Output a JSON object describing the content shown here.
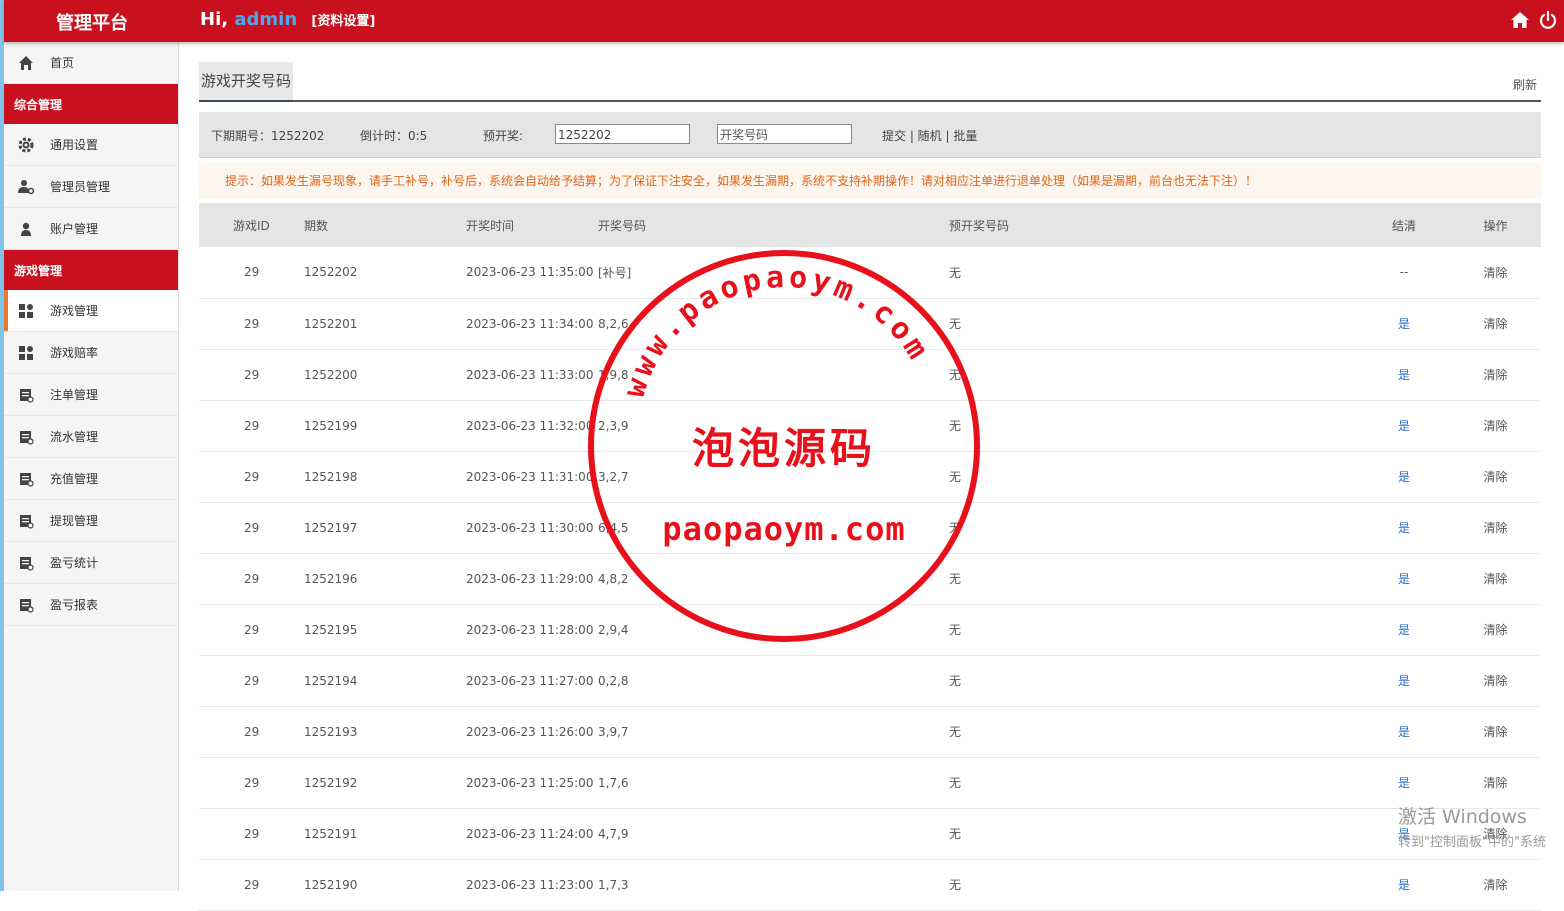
{
  "header": {
    "brand": "管理平台",
    "greeting": "Hi,",
    "user": "admin",
    "settings": "[资料设置]",
    "icons": [
      "home-icon",
      "power-icon"
    ]
  },
  "sidebar": {
    "home": "首页",
    "section1": "综合管理",
    "general": [
      "通用设置",
      "管理员管理",
      "账户管理"
    ],
    "section2": "游戏管理",
    "game": [
      "游戏管理",
      "游戏赔率",
      "注单管理",
      "流水管理",
      "充值管理",
      "提现管理",
      "盈亏统计",
      "盈亏报表"
    ]
  },
  "main": {
    "tab": "游戏开奖号码",
    "refresh": "刷新",
    "toolbar": {
      "next_period": "下期期号：1252202",
      "countdown": "倒计时：0:5",
      "preset_label": "预开奖:",
      "preset_value": "1252202",
      "number_placeholder": "开奖号码",
      "actions": "提交 | 随机 | 批量"
    },
    "notice": "提示：如果发生漏号现象，请手工补号，补号后，系统会自动给予结算；为了保证下注安全，如果发生漏期，系统不支持补期操作！请对相应注单进行退单处理（如果是漏期，前台也无法下注）！",
    "columns": [
      "游戏ID",
      "期数",
      "开奖时间",
      "开奖号码",
      "预开奖号码",
      "结清",
      "操作"
    ],
    "rows": [
      [
        "29",
        "1252202",
        "2023-06-23 11:35:00",
        "[补号]",
        "无",
        "--",
        "清除"
      ],
      [
        "29",
        "1252201",
        "2023-06-23 11:34:00",
        "8,2,6",
        "无",
        "是",
        "清除"
      ],
      [
        "29",
        "1252200",
        "2023-06-23 11:33:00",
        "1,9,8",
        "无",
        "是",
        "清除"
      ],
      [
        "29",
        "1252199",
        "2023-06-23 11:32:00",
        "2,3,9",
        "无",
        "是",
        "清除"
      ],
      [
        "29",
        "1252198",
        "2023-06-23 11:31:00",
        "3,2,7",
        "无",
        "是",
        "清除"
      ],
      [
        "29",
        "1252197",
        "2023-06-23 11:30:00",
        "6,4,5",
        "无",
        "是",
        "清除"
      ],
      [
        "29",
        "1252196",
        "2023-06-23 11:29:00",
        "4,8,2",
        "无",
        "是",
        "清除"
      ],
      [
        "29",
        "1252195",
        "2023-06-23 11:28:00",
        "2,9,4",
        "无",
        "是",
        "清除"
      ],
      [
        "29",
        "1252194",
        "2023-06-23 11:27:00",
        "0,2,8",
        "无",
        "是",
        "清除"
      ],
      [
        "29",
        "1252193",
        "2023-06-23 11:26:00",
        "3,9,7",
        "无",
        "是",
        "清除"
      ],
      [
        "29",
        "1252192",
        "2023-06-23 11:25:00",
        "1,7,6",
        "无",
        "是",
        "清除"
      ],
      [
        "29",
        "1252191",
        "2023-06-23 11:24:00",
        "4,7,9",
        "无",
        "是",
        "清除"
      ],
      [
        "29",
        "1252190",
        "2023-06-23 11:23:00",
        "1,7,3",
        "无",
        "是",
        "清除"
      ]
    ]
  },
  "stamp": {
    "arc_text": "www.paopaoym.com",
    "center_text": "泡泡源码",
    "bottom_text": "paopaoym.com"
  },
  "watermark": {
    "line1": "激活 Windows",
    "line2": "转到\"控制面板\"中的\"系统"
  },
  "colors": {
    "header_red": "#c9101f",
    "link_blue": "#2a6fc9",
    "notice_orange": "#e0651b",
    "active_marker": "#e8772e"
  }
}
